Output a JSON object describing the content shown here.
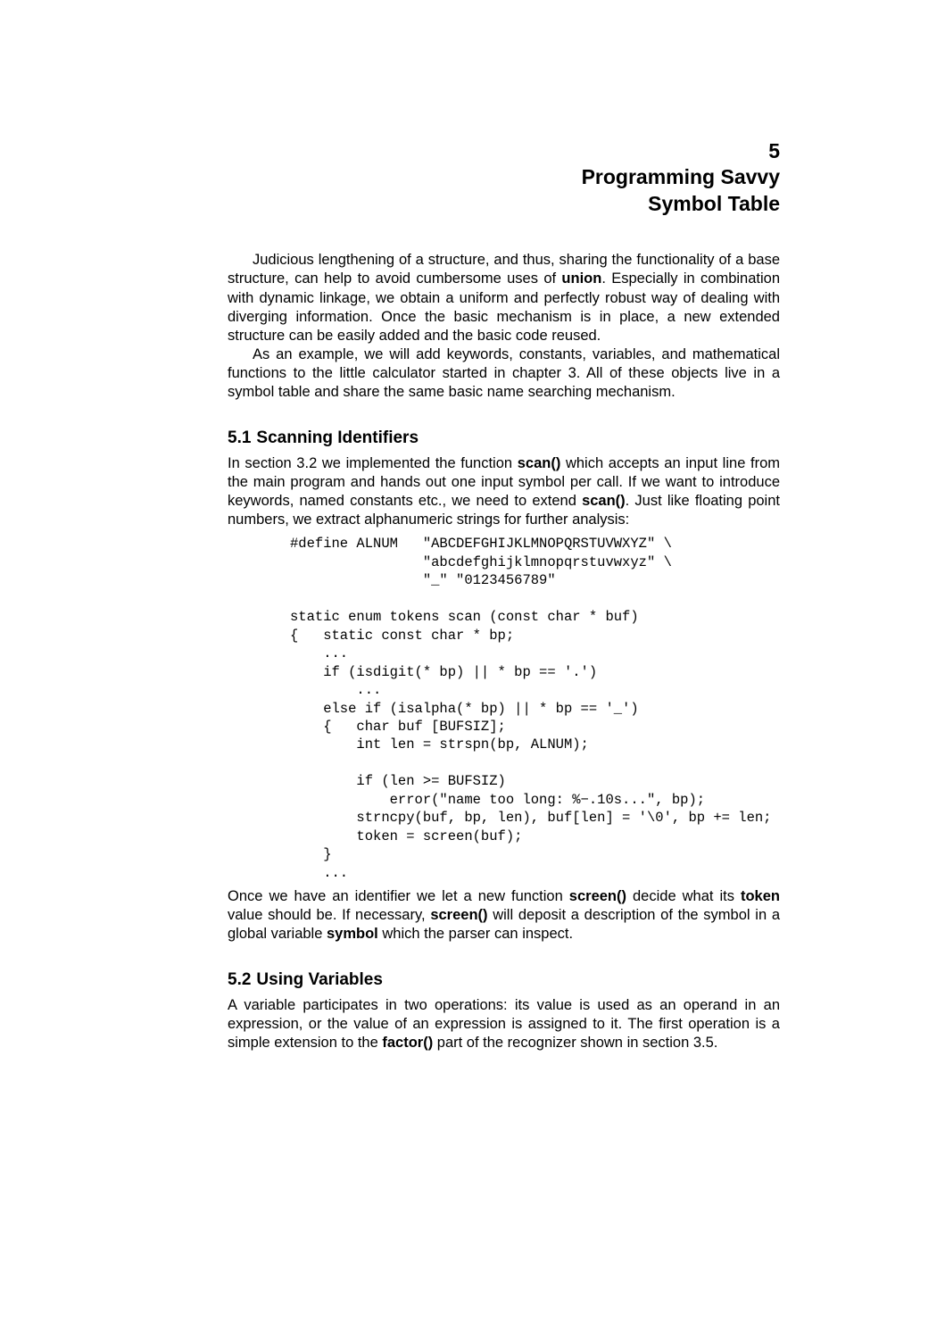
{
  "chapter": {
    "number": "5",
    "title_line1": "Programming Savvy",
    "title_line2": "Symbol Table"
  },
  "intro": {
    "p1_a": "Judicious lengthening of a structure, and thus, sharing the functionality of a base structure, can help to avoid cumbersome uses of ",
    "p1_bold1": "union",
    "p1_b": ". Especially in combination with dynamic linkage, we obtain a uniform and perfectly robust way of dealing with diverging information. Once the basic mechanism is in place, a new extended structure can be easily added and the basic code reused.",
    "p2": "As an example, we will add keywords, constants, variables, and mathematical functions to the little calculator started in chapter 3. All of these objects live in a symbol table and share the same basic name searching mechanism."
  },
  "section1": {
    "num": "5.1",
    "title": "Scanning Identifiers",
    "p1_a": "In section 3.2 we implemented the function ",
    "p1_bold1": "scan()",
    "p1_b": " which accepts an input line from the main program and hands out one input symbol per call. If we want to introduce keywords, named constants etc., we need to extend ",
    "p1_bold2": "scan()",
    "p1_c": ". Just like floating point numbers, we extract alphanumeric strings for further analysis:",
    "code": "#define ALNUM   \"ABCDEFGHIJKLMNOPQRSTUVWXYZ\" \\\n                \"abcdefghijklmnopqrstuvwxyz\" \\\n                \"_\" \"0123456789\"\n\nstatic enum tokens scan (const char * buf)\n{   static const char * bp;\n    ...\n    if (isdigit(* bp) || * bp == '.')\n        ...\n    else if (isalpha(* bp) || * bp == '_')\n    {   char buf [BUFSIZ];\n        int len = strspn(bp, ALNUM);\n\n        if (len >= BUFSIZ)\n            error(\"name too long: %−.10s...\", bp);\n        strncpy(buf, bp, len), buf[len] = '\\0', bp += len;\n        token = screen(buf);\n    }\n    ...",
    "p2_a": "Once we have an identifier we let a new function ",
    "p2_bold1": "screen()",
    "p2_b": " decide what its ",
    "p2_bold2": "token",
    "p2_c": " value should be. If necessary, ",
    "p2_bold3": "screen()",
    "p2_d": " will deposit a description of the symbol in a global variable ",
    "p2_bold4": "symbol",
    "p2_e": " which the parser can inspect."
  },
  "section2": {
    "num": "5.2",
    "title": "Using Variables",
    "p1_a": "A variable participates in two operations: its value is used as an operand in an expression, or the value of an expression is assigned to it. The first operation is a simple extension to the ",
    "p1_bold1": "factor()",
    "p1_b": " part of the recognizer shown in section 3.5."
  }
}
